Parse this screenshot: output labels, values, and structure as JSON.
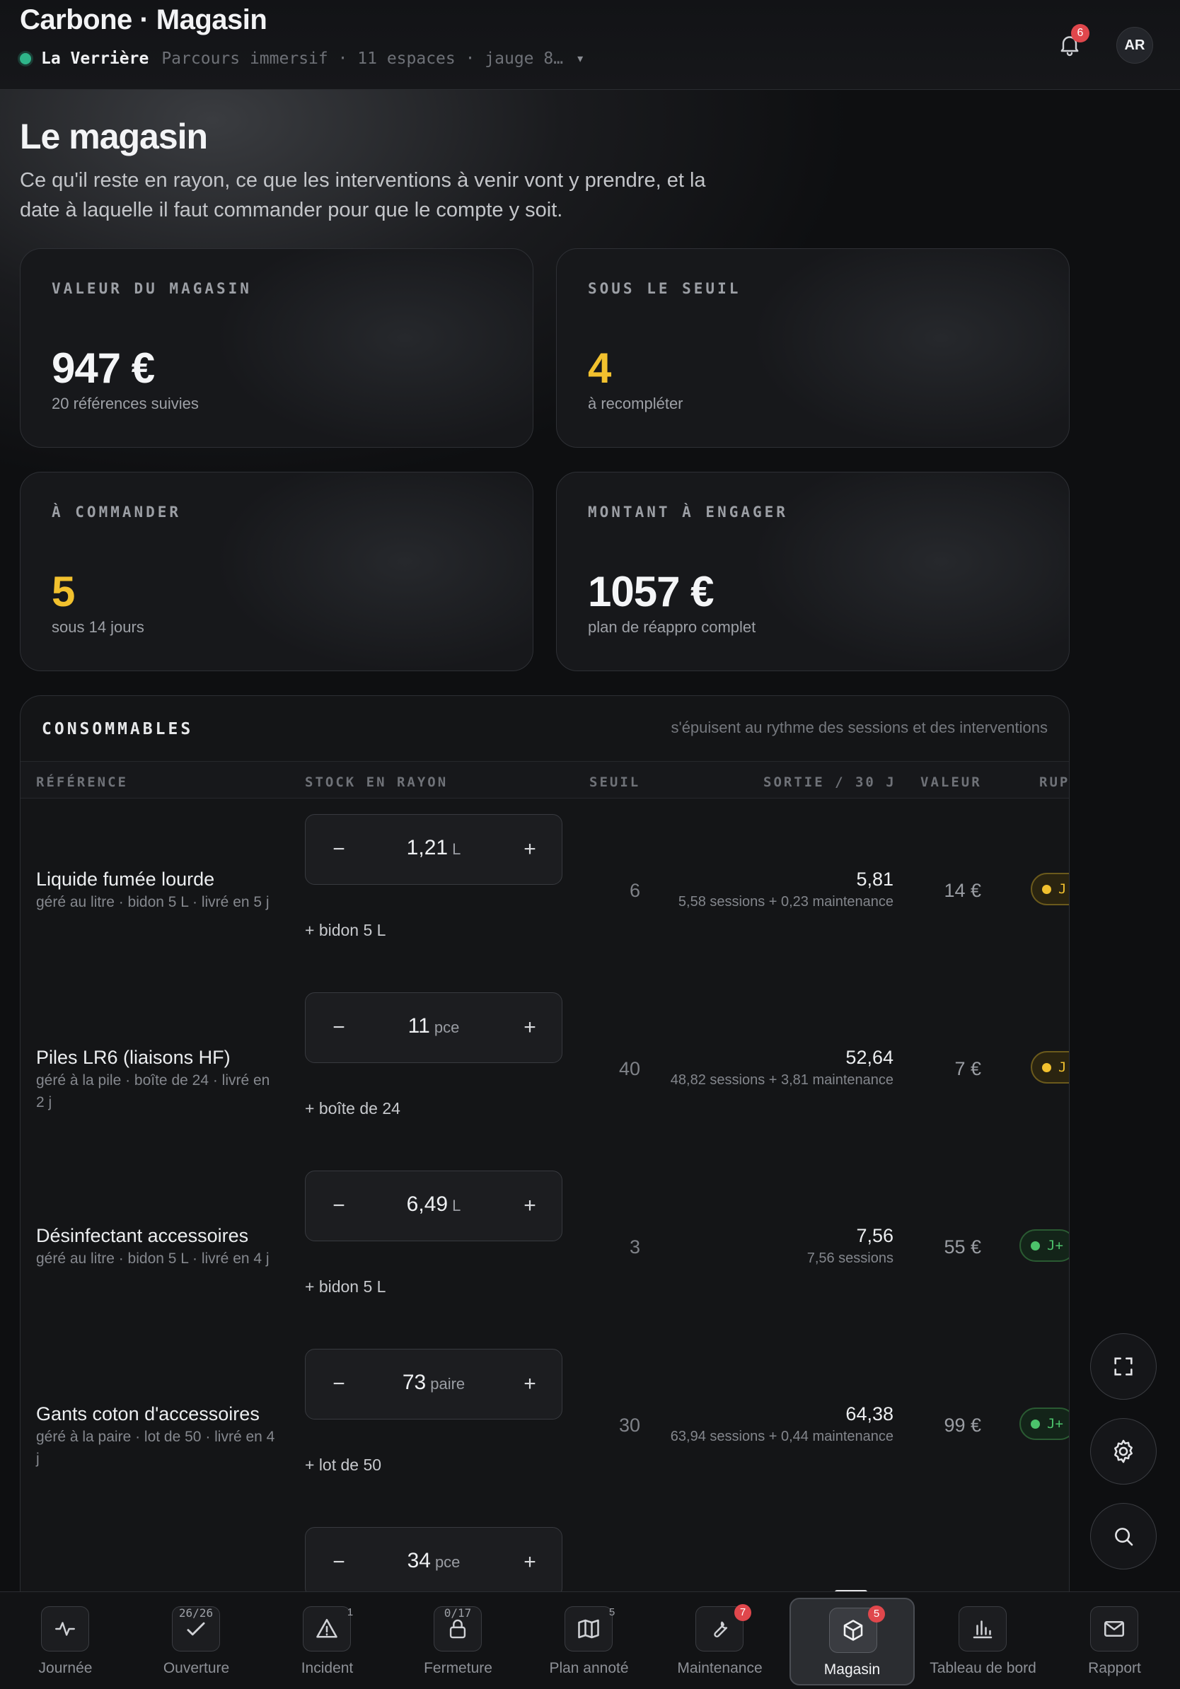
{
  "header": {
    "app_title": "Carbone · Magasin",
    "venue_name": "La Verrière",
    "venue_meta": "Parcours immersif · 11 espaces · jauge 8…",
    "caret": "▾",
    "notifications_count": "6",
    "avatar_initials": "AR"
  },
  "page": {
    "title": "Le magasin",
    "description": "Ce qu'il reste en rayon, ce que les interventions à venir vont y prendre, et la date à laquelle il faut commander pour que le compte y soit."
  },
  "kpis": [
    {
      "label": "VALEUR DU MAGASIN",
      "value": "947 €",
      "sub": "20 références suivies",
      "tone": "default"
    },
    {
      "label": "SOUS LE SEUIL",
      "value": "4",
      "sub": "à recompléter",
      "tone": "warn"
    },
    {
      "label": "À COMMANDER",
      "value": "5",
      "sub": "sous 14 jours",
      "tone": "warn"
    },
    {
      "label": "MONTANT À ENGAGER",
      "value": "1057 €",
      "sub": "plan de réappro complet",
      "tone": "default"
    }
  ],
  "table": {
    "title": "CONSOMMABLES",
    "note": "s'épuisent au rythme des sessions et des interventions",
    "columns": {
      "ref": "RÉFÉRENCE",
      "stock": "STOCK EN RAYON",
      "seuil": "SEUIL",
      "sortie": "SORTIE / 30 J",
      "valeur": "VALEUR",
      "rupture": "RUP"
    },
    "rows": [
      {
        "name": "Liquide fumée lourde",
        "meta": "géré au litre · bidon 5 L · livré en 5 j",
        "qty": "1,21",
        "unit": "L",
        "reorder": "+ bidon 5 L",
        "seuil": "6",
        "sortie": "5,81",
        "sortie_detail": "5,58 sessions + 0,23 maintenance",
        "valeur": "14 €",
        "status": "J",
        "tone": "warn"
      },
      {
        "name": "Piles LR6 (liaisons HF)",
        "meta": "géré à la pile · boîte de 24 · livré en 2 j",
        "qty": "11",
        "unit": "pce",
        "reorder": "+ boîte de 24",
        "seuil": "40",
        "sortie": "52,64",
        "sortie_detail": "48,82 sessions + 3,81 maintenance",
        "valeur": "7 €",
        "status": "J",
        "tone": "warn"
      },
      {
        "name": "Désinfectant accessoires",
        "meta": "géré au litre · bidon 5 L · livré en 4 j",
        "qty": "6,49",
        "unit": "L",
        "reorder": "+ bidon 5 L",
        "seuil": "3",
        "sortie": "7,56",
        "sortie_detail": "7,56 sessions",
        "valeur": "55 €",
        "status": "J+",
        "tone": "ok"
      },
      {
        "name": "Gants coton d'accessoires",
        "meta": "géré à la paire · lot de 50 · livré en 4 j",
        "qty": "73",
        "unit": "paire",
        "reorder": "+ lot de 50",
        "seuil": "30",
        "sortie": "64,38",
        "sortie_detail": "63,94 sessions + 0,44 maintenance",
        "valeur": "99 €",
        "status": "J+",
        "tone": "ok"
      },
      {
        "name": "",
        "meta": "",
        "qty": "34",
        "unit": "pce",
        "reorder": "",
        "seuil": "",
        "sortie": "",
        "sortie_detail": "",
        "valeur": "",
        "status": "",
        "tone": ""
      }
    ],
    "minus": "−",
    "plus": "+"
  },
  "nav": [
    {
      "label": "Journée",
      "icon": "activity-icon",
      "badge": "",
      "progress": ""
    },
    {
      "label": "Ouverture",
      "icon": "check-icon",
      "badge": "",
      "progress": "26/26"
    },
    {
      "label": "Incident",
      "icon": "warning-icon",
      "badge": "1",
      "progress": ""
    },
    {
      "label": "Fermeture",
      "icon": "lock-icon",
      "badge": "",
      "progress": "0/17"
    },
    {
      "label": "Plan annoté",
      "icon": "map-icon",
      "badge": "5",
      "progress": ""
    },
    {
      "label": "Maintenance",
      "icon": "wrench-icon",
      "badge": "7",
      "progress": ""
    },
    {
      "label": "Magasin",
      "icon": "box-icon",
      "badge": "5",
      "progress": ""
    },
    {
      "label": "Tableau de bord",
      "icon": "chart-icon",
      "badge": "",
      "progress": ""
    },
    {
      "label": "Rapport",
      "icon": "mail-icon",
      "badge": "",
      "progress": ""
    }
  ],
  "colors": {
    "accent_yellow": "#f2c12e",
    "ok_green": "#4cc26b",
    "badge_red": "#e0474c",
    "status_teal": "#2fb58a"
  }
}
